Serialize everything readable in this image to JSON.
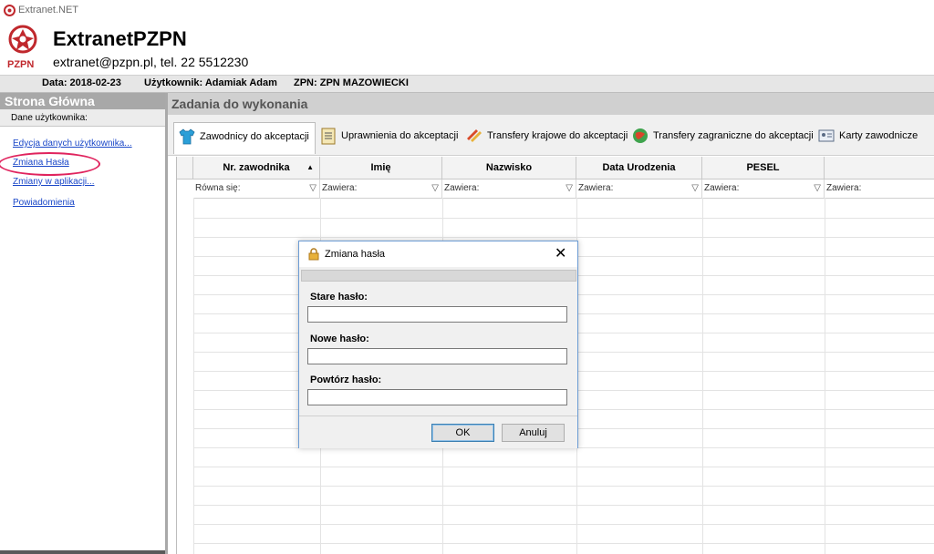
{
  "window": {
    "title": "Extranet.NET"
  },
  "header": {
    "app_name": "ExtranetPZPN",
    "contact": "extranet@pzpn.pl, tel. 22 5512230",
    "logo_text": "PZPN"
  },
  "infobar": {
    "date": "Data: 2018-02-23",
    "user": "Użytkownik: Adamiak Adam",
    "zpn": "ZPN: ZPN MAZOWIECKI"
  },
  "sidebar": {
    "title": "Strona Główna",
    "section": "Dane użytkownika:",
    "links": [
      "Edycja danych użytkownika...",
      "Zmiana Hasła",
      "Zmiany w aplikacji...",
      "Powiadomienia"
    ]
  },
  "main": {
    "title": "Zadania do wykonania",
    "tabs": [
      {
        "label": "Zawodnicy do akceptacji",
        "icon": "shirt-icon",
        "active": true
      },
      {
        "label": "Uprawnienia do akceptacji",
        "icon": "notepad-icon"
      },
      {
        "label": "Transfery krajowe do akceptacji",
        "icon": "transfer-arrows-icon"
      },
      {
        "label": "Transfery zagraniczne do akceptacji",
        "icon": "globe-icon"
      },
      {
        "label": "Karty zawodnicze",
        "icon": "id-card-icon"
      }
    ]
  },
  "grid": {
    "columns": [
      "Nr. zawodnika",
      "Imię",
      "Nazwisko",
      "Data Urodzenia",
      "PESEL",
      ""
    ],
    "filters": [
      "Równa się:",
      "Zawiera:",
      "Zawiera:",
      "Zawiera:",
      "Zawiera:",
      "Zawiera:"
    ]
  },
  "modal": {
    "title": "Zmiana hasła",
    "fields": [
      "Stare hasło:",
      "Nowe hasło:",
      "Powtórz hasło:"
    ],
    "ok": "OK",
    "cancel": "Anuluj"
  },
  "colors": {
    "link": "#1a47c8",
    "highlight": "#e0245e",
    "accent": "#6c9cd4"
  }
}
